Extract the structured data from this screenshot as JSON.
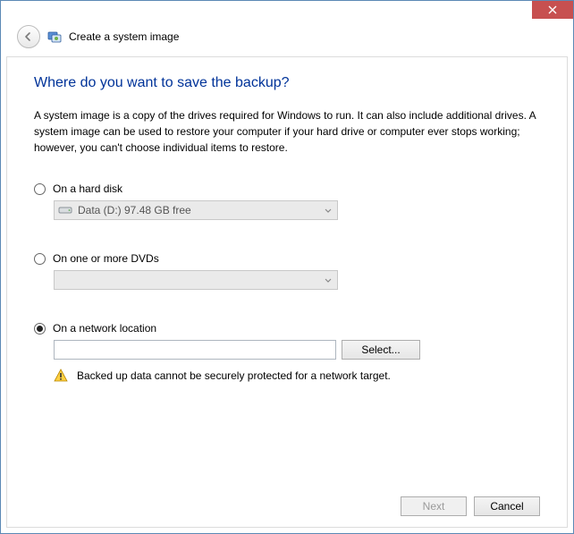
{
  "window": {
    "title": "Create a system image"
  },
  "page": {
    "heading": "Where do you want to save the backup?",
    "description": "A system image is a copy of the drives required for Windows to run. It can also include additional drives. A system image can be used to restore your computer if your hard drive or computer ever stops working; however, you can't choose individual items to restore."
  },
  "options": {
    "hard_disk": {
      "label": "On a hard disk",
      "selected_drive": "Data (D:)  97.48 GB free",
      "checked": false
    },
    "dvds": {
      "label": "On one or more DVDs",
      "selected_drive": "",
      "checked": false
    },
    "network": {
      "label": "On a network location",
      "path": "",
      "select_button": "Select...",
      "warning": "Backed up data cannot be securely protected for a network target.",
      "checked": true
    }
  },
  "buttons": {
    "next": "Next",
    "cancel": "Cancel"
  }
}
